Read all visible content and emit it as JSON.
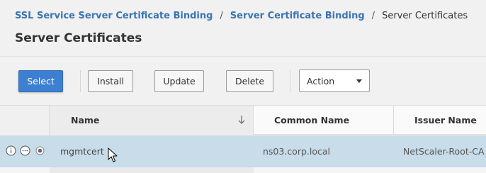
{
  "breadcrumb": {
    "items": [
      {
        "label": "SSL Service Server Certificate Binding"
      },
      {
        "label": "Server Certificate Binding"
      },
      {
        "label": "Server Certificates"
      }
    ],
    "separator": "/"
  },
  "page": {
    "title": "Server Certificates"
  },
  "toolbar": {
    "select_label": "Select",
    "install_label": "Install",
    "update_label": "Update",
    "delete_label": "Delete",
    "action_label": "Action"
  },
  "table": {
    "columns": {
      "name": "Name",
      "common_name": "Common Name",
      "issuer_name": "Issuer Name"
    },
    "rows": [
      {
        "name": "mgmtcert",
        "common_name": "ns03.corp.local",
        "issuer_name": "NetScaler-Root-CA",
        "selected": true
      }
    ]
  },
  "icons": {
    "sort": "arrow-down-icon",
    "row_info": "info-icon",
    "row_more": "ellipsis-icon",
    "row_radio": "radio-selected-icon",
    "cursor": "mouse-pointer-icon"
  },
  "colors": {
    "link": "#3a74b3",
    "primary_button": "#3d7fd1",
    "selected_row": "#c8dcea"
  }
}
